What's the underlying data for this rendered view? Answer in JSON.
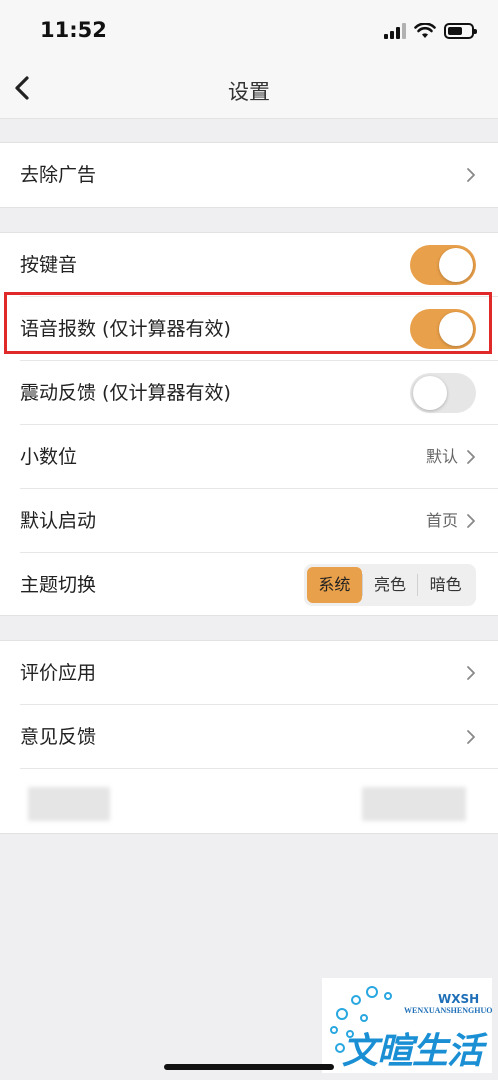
{
  "status_bar": {
    "time": "11:52"
  },
  "nav": {
    "title": "设置"
  },
  "group1": [
    {
      "label": "去除广告"
    }
  ],
  "group2": {
    "key_sound": {
      "label": "按键音",
      "on": true
    },
    "voice": {
      "label": "语音报数 (仅计算器有效)",
      "on": true
    },
    "vibration": {
      "label": "震动反馈 (仅计算器有效)",
      "on": false
    },
    "decimal": {
      "label": "小数位",
      "value": "默认"
    },
    "startup": {
      "label": "默认启动",
      "value": "首页"
    },
    "theme": {
      "label": "主题切换",
      "options": [
        "系统",
        "亮色",
        "暗色"
      ],
      "selected": "系统"
    }
  },
  "group3": {
    "rate": {
      "label": "评价应用"
    },
    "feedback": {
      "label": "意见反馈"
    }
  },
  "watermark": {
    "cn": "文暄生活",
    "en": "WENXUANSHENGHUO",
    "small": "WXSH"
  },
  "colors": {
    "accent": "#e9a04a",
    "highlight": "#e02a2a",
    "background": "#efeff1"
  }
}
